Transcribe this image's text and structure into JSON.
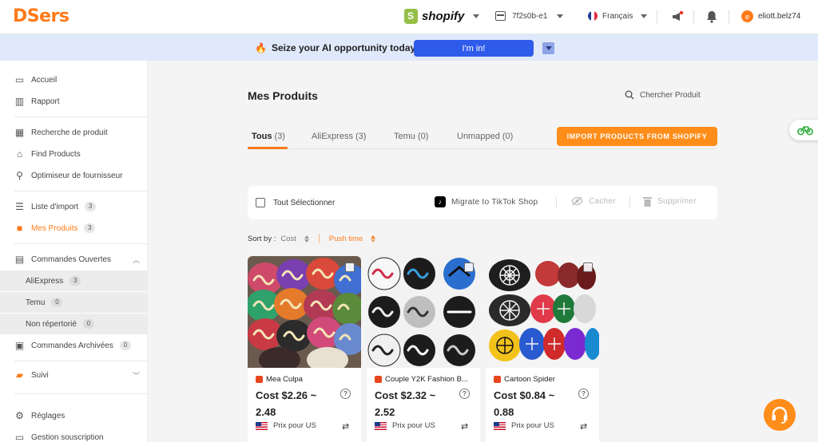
{
  "header": {
    "logo": "DSers",
    "platform": "shopify",
    "store": "7f2s0b-e1",
    "language": "Français",
    "user_initial": "e",
    "user_name": "eliott.belz74"
  },
  "banner": {
    "text": "Seize your AI opportunity today!",
    "button": "I'm in!"
  },
  "sidebar": {
    "items": [
      {
        "label": "Accueil",
        "icon": "store-icon"
      },
      {
        "label": "Rapport",
        "icon": "chart-icon"
      },
      {
        "label": "Recherche de produit",
        "icon": "grid-search-icon"
      },
      {
        "label": "Find Products",
        "icon": "home-icon"
      },
      {
        "label": "Optimiseur de fournisseur",
        "icon": "search-icon"
      },
      {
        "label": "Liste d'import",
        "badge": "3",
        "icon": "list-icon"
      },
      {
        "label": "Mes Produits",
        "badge": "3",
        "icon": "bag-icon"
      },
      {
        "label": "Commandes Ouvertes",
        "icon": "clipboard-icon"
      },
      {
        "label": "Commandes Archivées",
        "badge": "0",
        "icon": "archive-icon"
      },
      {
        "label": "Suivi",
        "icon": "truck-icon"
      },
      {
        "label": "Réglages",
        "icon": "gear-icon"
      },
      {
        "label": "Gestion souscription",
        "icon": "card-icon"
      }
    ],
    "sub_items": [
      {
        "label": "AliExpress",
        "badge": "3"
      },
      {
        "label": "Temu",
        "badge": "0"
      },
      {
        "label": "Non répertorié",
        "badge": "0"
      }
    ]
  },
  "main": {
    "title": "Mes Produits",
    "search_label": "Chercher Produit",
    "tabs": [
      {
        "label": "Tous",
        "count": "(3)"
      },
      {
        "label": "AliExpress (3)"
      },
      {
        "label": "Temu (0)"
      },
      {
        "label": "Unmapped (0)"
      }
    ],
    "import_button": "IMPORT PRODUCTS FROM SHOPIFY",
    "select_all": "Tout Sélectionner",
    "migrate": "Migrate to TikTok Shop",
    "hide": "Cacher",
    "delete": "Supprimer",
    "sort_by": "Sort by :",
    "sort_cost": "Cost",
    "sort_push": "Push time"
  },
  "products": [
    {
      "title": "Mea Culpa",
      "cost": "Cost $2.26 ~ 2.48",
      "price_label": "Prix pour US"
    },
    {
      "title": "Couple Y2K Fashion B...",
      "cost": "Cost $2.32 ~ 2.52",
      "price_label": "Prix pour US"
    },
    {
      "title": "Cartoon Spider",
      "cost": "Cost $0.84 ~ 0.88",
      "price_label": "Prix pour US"
    }
  ],
  "colors": {
    "accent": "#ff7a1a",
    "banner_button": "#2f5bea",
    "banner_bg": "#dfe9fb"
  }
}
